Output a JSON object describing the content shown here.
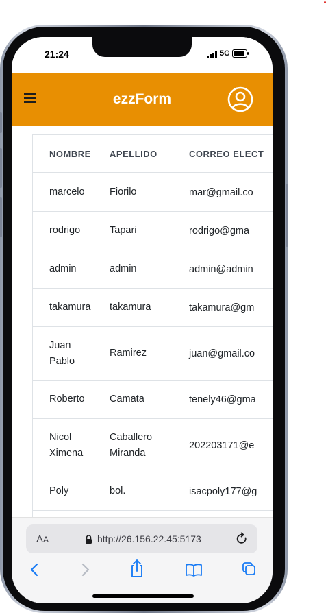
{
  "status_bar": {
    "time": "21:24",
    "network": "5G"
  },
  "header": {
    "title": "ezzForm"
  },
  "table": {
    "headers": [
      "NOMBRE",
      "APELLIDO",
      "CORREO ELECT"
    ],
    "rows": [
      {
        "nombre": [
          "marcelo"
        ],
        "apellido": [
          "Fiorilo"
        ],
        "correo": "mar@gmail.co"
      },
      {
        "nombre": [
          "rodrigo"
        ],
        "apellido": [
          "Tapari"
        ],
        "correo": "rodrigo@gma"
      },
      {
        "nombre": [
          "admin"
        ],
        "apellido": [
          "admin"
        ],
        "correo": "admin@admin"
      },
      {
        "nombre": [
          "takamura"
        ],
        "apellido": [
          "takamura"
        ],
        "correo": "takamura@gm"
      },
      {
        "nombre": [
          "Juan",
          "Pablo"
        ],
        "apellido": [
          "Ramirez"
        ],
        "correo": "juan@gmail.co"
      },
      {
        "nombre": [
          "Roberto"
        ],
        "apellido": [
          "Camata"
        ],
        "correo": "tenely46@gma"
      },
      {
        "nombre": [
          "Nicol",
          "Ximena"
        ],
        "apellido": [
          "Caballero",
          "Miranda"
        ],
        "correo": "202203171@e"
      },
      {
        "nombre": [
          "Poly"
        ],
        "apellido": [
          "bol."
        ],
        "correo": "isacpoly177@g"
      }
    ]
  },
  "browser": {
    "aa_big": "A",
    "aa_small": "A",
    "url": "http://26.156.22.45:5173"
  },
  "colors": {
    "header_bg": "#e88f02",
    "link_blue": "#1a7cf5"
  },
  "icons": [
    "menu-icon",
    "user-circle-icon",
    "lock-icon",
    "reload-icon",
    "back-icon",
    "forward-icon",
    "share-icon",
    "bookmarks-icon",
    "tabs-icon"
  ]
}
